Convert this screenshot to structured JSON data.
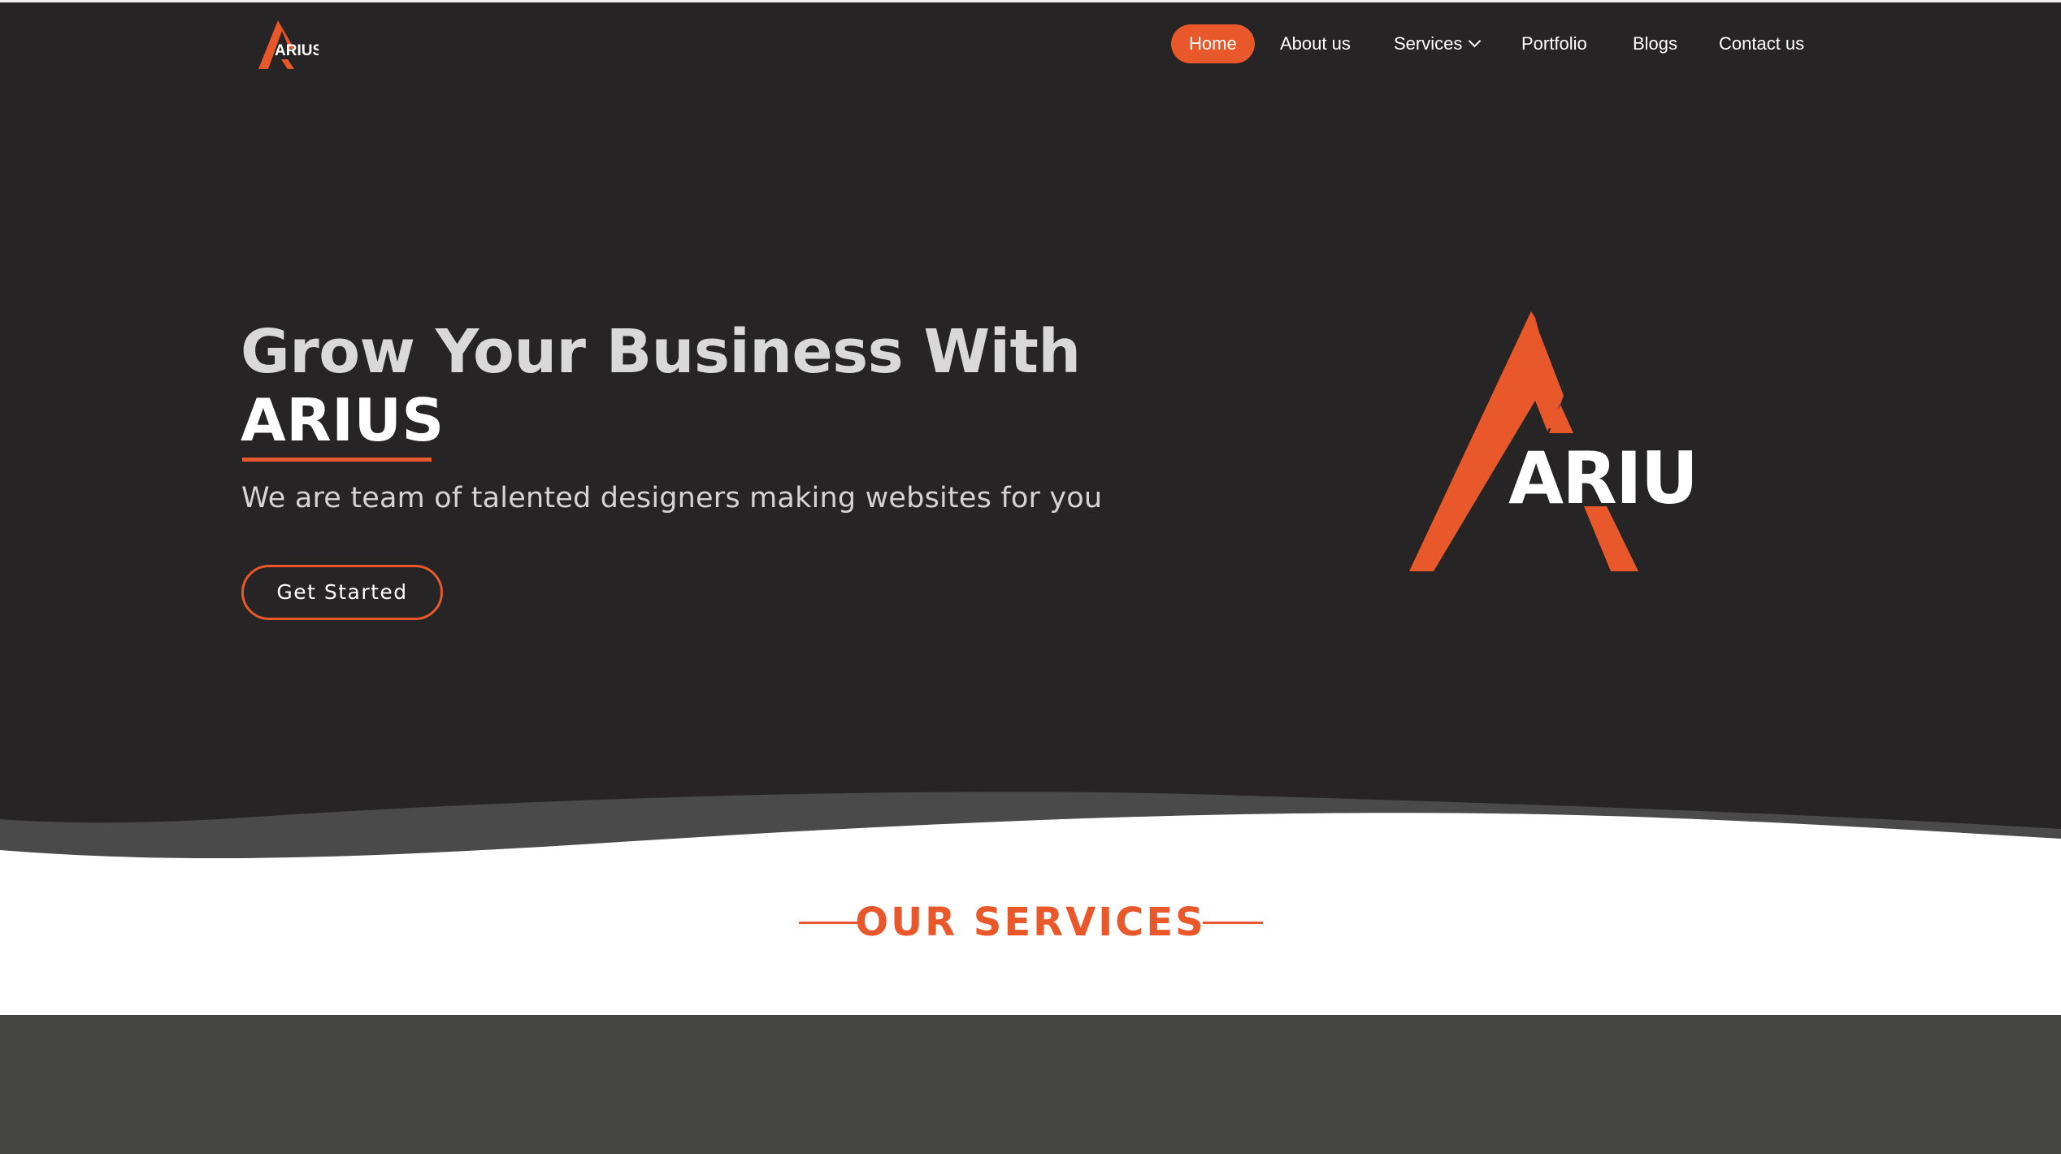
{
  "brand": {
    "logo_text": "ARIUS",
    "accent_color": "#e8582a",
    "hero_background": "#262424",
    "band_background": "#444443"
  },
  "nav": {
    "items": [
      {
        "label": "Home",
        "active": true
      },
      {
        "label": "About us"
      },
      {
        "label": "Services",
        "has_dropdown": true,
        "icon": "chevron-down-icon"
      },
      {
        "label": "Portfolio"
      },
      {
        "label": "Blogs"
      },
      {
        "label": "Contact us"
      }
    ]
  },
  "hero": {
    "headline": "Grow Your Business With",
    "brand_word": "ARIUS",
    "subheadline": "We are team of talented designers making websites for you",
    "cta_label": "Get Started"
  },
  "services": {
    "title": "OUR SERVICES"
  }
}
